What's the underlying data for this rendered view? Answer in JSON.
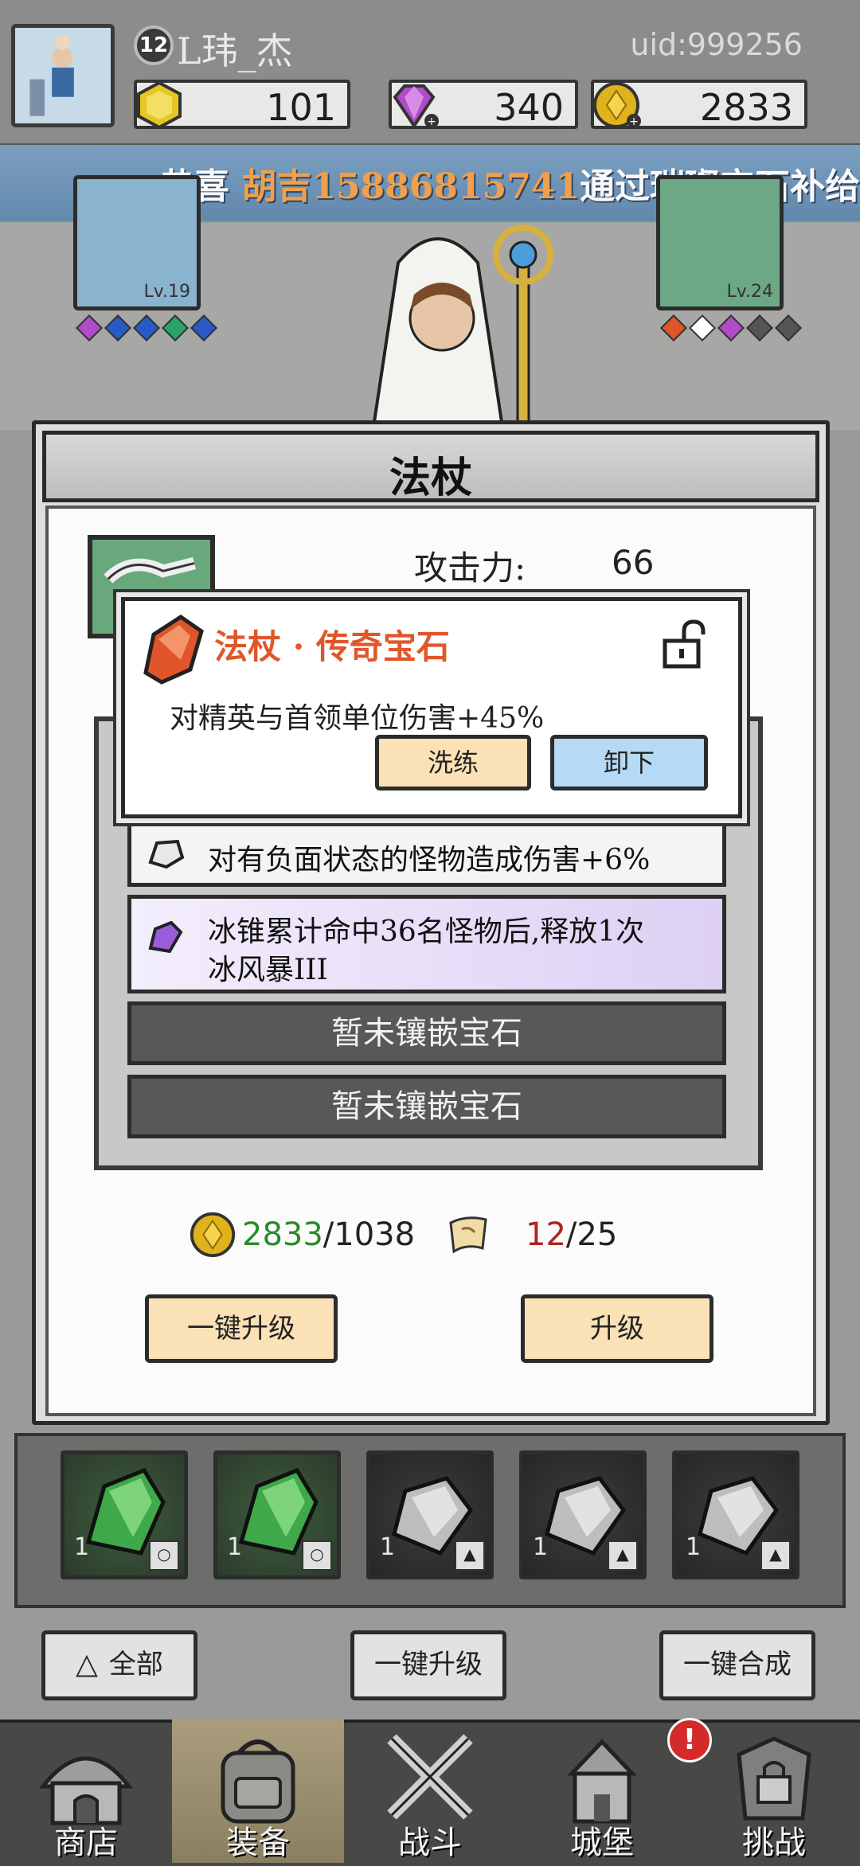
{
  "player": {
    "level": "12",
    "name": "L玮_杰",
    "uid": "uid:999256"
  },
  "resources": {
    "gold_gem": "101",
    "diamond": "340",
    "coin": "2833"
  },
  "ticker": {
    "prefix": "恭喜 ",
    "player": "胡吉15886815741",
    "suffix": "通过璀璨宝石补给箱获"
  },
  "background_slots": {
    "left_level": "Lv.19",
    "right_level": "Lv.24"
  },
  "modal": {
    "title": "法杖",
    "attack_label": "攻击力:",
    "attack_value": "66"
  },
  "popup": {
    "title": "法杖 · 传奇宝石",
    "description": "对精英与首领单位伤害+45%",
    "reforge_label": "洗练",
    "remove_label": "卸下"
  },
  "gem_slots": [
    {
      "text": "对有负面状态的怪物造成伤害+6%"
    },
    {
      "text_line1": "冰锥累计命中36名怪物后,释放1次",
      "text_line2": "冰风暴III"
    },
    {
      "text": "暂未镶嵌宝石"
    },
    {
      "text": "暂未镶嵌宝石"
    }
  ],
  "costs": {
    "coin_have": "2833",
    "coin_need": "/1038",
    "scroll_have": "12",
    "scroll_need": "/25"
  },
  "buttons": {
    "one_key_upgrade": "一键升级",
    "upgrade": "升级"
  },
  "inventory": [
    {
      "count": "1",
      "kind": "green"
    },
    {
      "count": "1",
      "kind": "green"
    },
    {
      "count": "1",
      "kind": "gray"
    },
    {
      "count": "1",
      "kind": "gray"
    },
    {
      "count": "1",
      "kind": "gray"
    }
  ],
  "actions": {
    "filter_all": "全部",
    "bulk_upgrade": "一键升级",
    "bulk_merge": "一键合成"
  },
  "nav": {
    "shop": "商店",
    "equip": "装备",
    "battle": "战斗",
    "castle": "城堡",
    "challenge": "挑战",
    "alert": "!"
  },
  "colors": {
    "accent_orange": "#e0562a",
    "ticker_bg": "#6b93b8",
    "cream_button": "#fbe1b6",
    "blue_button": "#b6daf6"
  }
}
